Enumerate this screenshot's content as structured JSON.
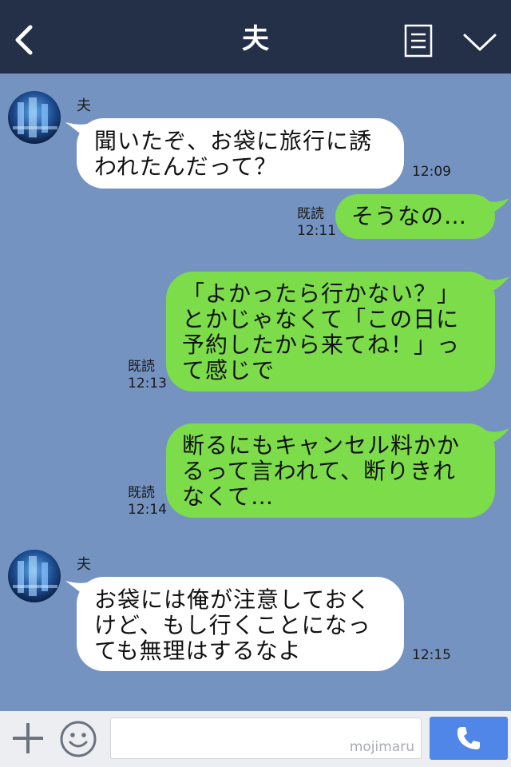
{
  "header": {
    "title": "夫",
    "icons": [
      "back-icon",
      "notes-icon",
      "chevron-down-icon"
    ]
  },
  "messages": [
    {
      "sender": "夫",
      "text": "聞いたぞ、お袋に旅行に誘\nわれたんだって？",
      "time": "12:09"
    },
    {
      "text": "そうなの…",
      "read": "既読",
      "time": "12:11"
    },
    {
      "text": "「よかったら行かない？」\nとかじゃなくて「この日に\n予約したから来てね！」っ\nて感じで",
      "read": "既読",
      "time": "12:13"
    },
    {
      "text": "断るにもキャンセル料かか\nるって言われて、断りきれ\nなくて…",
      "read": "既読",
      "time": "12:14"
    },
    {
      "sender": "夫",
      "text": "お袋には俺が注意しておく\nけど、もし行くことになっ\nても無理はするなよ",
      "time": "12:15"
    }
  ],
  "footer": {
    "watermark": "mojimaru",
    "icons": [
      "plus-icon",
      "smile-icon",
      "phone-icon"
    ]
  },
  "colors": {
    "header": "#243048",
    "background": "#7493c1",
    "outgoing": "#7ddc49",
    "incoming": "#ffffff",
    "call_button": "#4f86e8"
  }
}
